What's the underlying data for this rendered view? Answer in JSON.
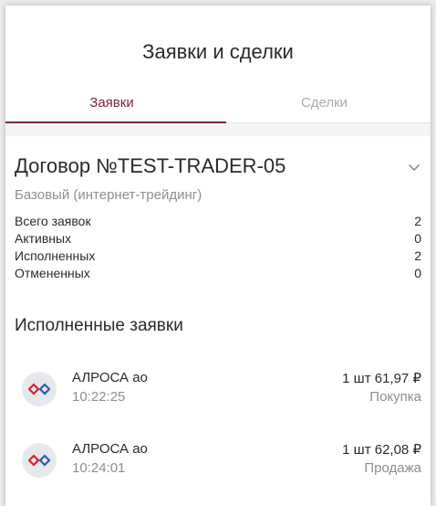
{
  "header": {
    "title": "Заявки и сделки"
  },
  "tabs": [
    {
      "label": "Заявки",
      "active": true
    },
    {
      "label": "Сделки",
      "active": false
    }
  ],
  "contract": {
    "title": "Договор №TEST-TRADER-05",
    "subtitle": "Базовый (интернет-трейдинг)",
    "stats": [
      {
        "label": "Всего заявок",
        "value": "2"
      },
      {
        "label": "Активных",
        "value": "0"
      },
      {
        "label": "Исполненных",
        "value": "2"
      },
      {
        "label": "Отмененных",
        "value": "0"
      }
    ]
  },
  "executed": {
    "title": "Исполненные заявки",
    "orders": [
      {
        "name": "АЛРОСА ао",
        "time": "10:22:25",
        "amount": "1 шт 61,97 ₽",
        "type": "Покупка",
        "icon": "alrosa-logo-icon"
      },
      {
        "name": "АЛРОСА ао",
        "time": "10:24:01",
        "amount": "1 шт 62,08 ₽",
        "type": "Продажа",
        "icon": "alrosa-logo-icon"
      }
    ]
  },
  "colors": {
    "accent": "#7a2347",
    "muted": "#8f8f8f",
    "logo_red": "#d2232a",
    "logo_blue": "#2a5ca8"
  }
}
